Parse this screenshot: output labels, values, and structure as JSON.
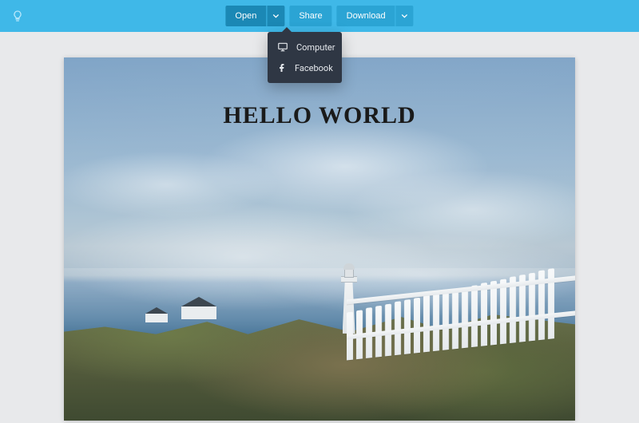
{
  "colors": {
    "topbar": "#3fb8e8",
    "button": "#2ba4d4",
    "button_active": "#1b88b5",
    "dropdown_bg": "#2f3744"
  },
  "toolbar": {
    "open_label": "Open",
    "share_label": "Share",
    "download_label": "Download"
  },
  "open_menu": {
    "items": [
      {
        "icon": "monitor-icon",
        "label": "Computer"
      },
      {
        "icon": "facebook-icon",
        "label": "Facebook"
      }
    ]
  },
  "canvas": {
    "headline": "HELLO WORLD"
  }
}
